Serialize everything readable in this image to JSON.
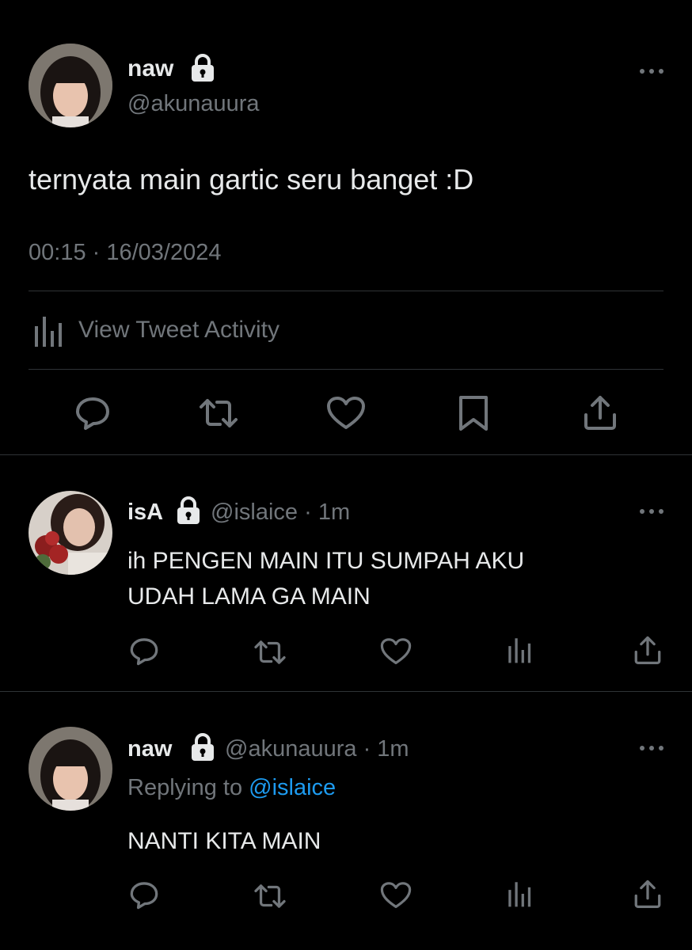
{
  "main_tweet": {
    "name": "naw",
    "handle": "@akunauura",
    "text": "ternyata main gartic seru banget :D",
    "timestamp": "00:15 · 16/03/2024",
    "activity_label": "View Tweet Activity",
    "actions": [
      "reply-icon",
      "retweet-icon",
      "like-icon",
      "bookmark-icon",
      "share-icon"
    ]
  },
  "replies": [
    {
      "name": "isA",
      "handle": "@islaice",
      "separator": "·",
      "time": "1m",
      "text_line1": "ih PENGEN MAIN ITU SUMPAH AKU",
      "text_line2": "UDAH LAMA GA MAIN",
      "actions": [
        "reply-icon",
        "retweet-icon",
        "like-icon",
        "views-icon",
        "share-icon"
      ]
    },
    {
      "name": "naw",
      "handle": "@akunauura",
      "separator": "·",
      "time": "1m",
      "replying_prefix": "Replying to",
      "replying_to": "@islaice",
      "text": "NANTI KITA MAIN",
      "actions": [
        "reply-icon",
        "retweet-icon",
        "like-icon",
        "views-icon",
        "share-icon"
      ]
    }
  ],
  "colors": {
    "background": "#000000",
    "text_primary": "#e7e9ea",
    "text_secondary": "#71767b",
    "link": "#1d9bf0",
    "divider": "#2f3336"
  }
}
